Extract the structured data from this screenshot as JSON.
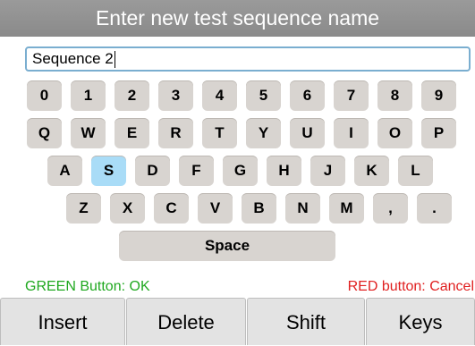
{
  "title": "Enter new test sequence name",
  "entry": {
    "value": "Sequence 2"
  },
  "keyboard": {
    "rows": [
      [
        "0",
        "1",
        "2",
        "3",
        "4",
        "5",
        "6",
        "7",
        "8",
        "9"
      ],
      [
        "Q",
        "W",
        "E",
        "R",
        "T",
        "Y",
        "U",
        "I",
        "O",
        "P"
      ],
      [
        "A",
        "S",
        "D",
        "F",
        "G",
        "H",
        "J",
        "K",
        "L"
      ],
      [
        "Z",
        "X",
        "C",
        "V",
        "B",
        "N",
        "M",
        ",",
        "."
      ]
    ],
    "space_label": "Space",
    "selected_key": "S"
  },
  "hints": {
    "ok": "GREEN Button: OK",
    "cancel": "RED button: Cancel"
  },
  "softkeys": [
    "Insert",
    "Delete",
    "Shift",
    "Keys"
  ],
  "colors": {
    "titlebar": "#8a8a8a",
    "key": "#d8d4d0",
    "key_selected": "#a9dcf7",
    "ok_text": "#1fa81f",
    "cancel_text": "#e02020"
  }
}
